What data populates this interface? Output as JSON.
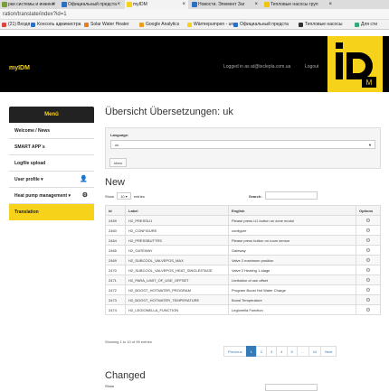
{
  "browser": {
    "tabs": [
      {
        "label": "рки системы и инжене",
        "color": "#7a9e3c"
      },
      {
        "label": "Официальный предста",
        "color": "#2d6fc4"
      },
      {
        "label": "myIDM",
        "color": "#f7d21b"
      },
      {
        "label": "Новости. Элемент Заг",
        "color": "#2d6fc4"
      },
      {
        "label": "Тепловые насосы груп",
        "color": "#f1c40f"
      }
    ],
    "url": "ration/translate/index?id=1",
    "bookmarks": [
      {
        "label": "(21) Входя",
        "color": "#d44"
      },
      {
        "label": "Консоль администра",
        "color": "#2d6fc4"
      },
      {
        "label": "Solar Water Heater",
        "color": "#e67e22"
      },
      {
        "label": "Google Analytics",
        "color": "#e8a020"
      },
      {
        "label": "Wärmepumpen - un",
        "color": "#f7d21b"
      },
      {
        "label": "Официальный предста",
        "color": "#2d6fc4"
      },
      {
        "label": "Тепловые насосы",
        "color": "#333"
      },
      {
        "label": "Для сти",
        "color": "#3a7"
      }
    ]
  },
  "header": {
    "brand": "myIDM",
    "logged_in": "Logged in as at@teclepla.com.ua",
    "logout": "Logout"
  },
  "sidebar": {
    "title": "Menü",
    "items": [
      {
        "label": "Welcome / News",
        "icon": ""
      },
      {
        "label": "SMART APP´s",
        "icon": ""
      },
      {
        "label": "Logfile upload",
        "icon": ""
      },
      {
        "label": "User profile ▾",
        "icon": "👤"
      },
      {
        "label": "Heat pump management ▾",
        "icon": "⚙"
      },
      {
        "label": "Translation",
        "icon": ""
      }
    ]
  },
  "main": {
    "title": "Übersicht Übersetzungen: uk",
    "language_label": "Language:",
    "language_value": "uk",
    "show_button": "show",
    "new_title": "New",
    "show_prefix": "Show",
    "show_length": "10",
    "show_suffix": "entries",
    "search_label": "Search:",
    "columns": [
      "id",
      "Label",
      "English",
      "Options"
    ],
    "rows": [
      {
        "id": "2459",
        "label": "H2_PRESSLI1",
        "english": "Please press U1 button on zone modul"
      },
      {
        "id": "2460",
        "label": "H2_CONFIGURE",
        "english": "configure"
      },
      {
        "id": "2464",
        "label": "H2_PRESSBUTTRS",
        "english": "Please press button on room sensor"
      },
      {
        "id": "2465",
        "label": "H2_GATEWAY",
        "english": "Gateway"
      },
      {
        "id": "2469",
        "label": "H2_SUBCOOL_VALVEPOS_MAX",
        "english": "Valve 2 maximum position"
      },
      {
        "id": "2470",
        "label": "H2_SUBCOOL_VALVEPOS_HEAT_SINGLESTAGE",
        "english": "Valve 2 Heating 1-stage"
      },
      {
        "id": "2471",
        "label": "H2_PARA_LIMIT_OF_USE_OFFSET",
        "english": "Limitation of use offset"
      },
      {
        "id": "2472",
        "label": "H2_BOOST_HOTWATER_PROGRAM",
        "english": "Program Boost Hot Water Charge"
      },
      {
        "id": "2473",
        "label": "H2_BOOST_HOTWATER_TEMPERATURE",
        "english": "Boost Temperature"
      },
      {
        "id": "2474",
        "label": "H2_LEGIONELLA_FUNCTION",
        "english": "Legionella Function"
      }
    ],
    "info": "Showing 1 to 10 of 95 entries",
    "pager": [
      "Previous",
      "1",
      "2",
      "3",
      "4",
      "5",
      "…",
      "10",
      "Next"
    ],
    "changed_title": "Changed"
  },
  "colors": {
    "accent": "#f7d21b",
    "nav": "#000000",
    "link": "#337ab7"
  }
}
